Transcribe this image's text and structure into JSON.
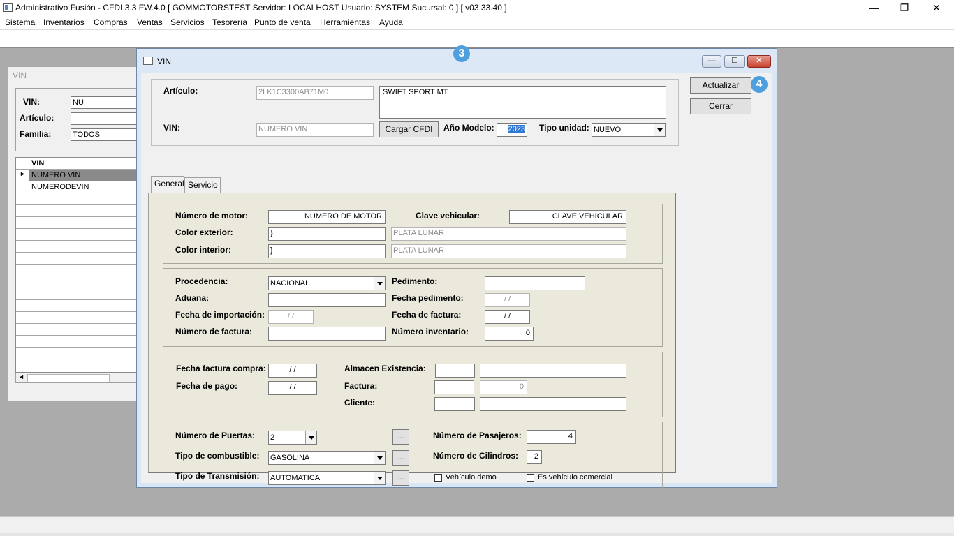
{
  "app": {
    "title": "Administrativo Fusión - CFDI 3.3 FW.4.0 [ GOMMOTORSTEST  Servidor: LOCALHOST  Usuario: SYSTEM    Sucursal: 0 ] [ v03.33.40 ]",
    "minimize": "—",
    "maximize": "❐",
    "close": "✕"
  },
  "menu": [
    "Sistema",
    "Inventarios",
    "Compras",
    "Ventas",
    "Servicios",
    "Tesorería",
    "Punto de venta",
    "Herramientas",
    "Ayuda"
  ],
  "background_window": {
    "title": "VIN",
    "vin_label": "VIN:",
    "vin_value": "NU",
    "articulo_label": "Artículo:",
    "articulo_value": "",
    "familia_label": "Familia:",
    "familia_value": "TODOS",
    "grid_header": "VIN",
    "rows": [
      "NUMERO VIN",
      "NUMERODEVIN"
    ]
  },
  "vin_window": {
    "title": "VIN",
    "articulo_label": "Artículo:",
    "articulo_code": "2LK1C3300AB71M0",
    "articulo_desc": "SWIFT SPORT MT",
    "vin_label": "VIN:",
    "vin_value": "NUMERO VIN",
    "cargar_cfdi": "Cargar CFDI",
    "anio_label": "Año Modelo:",
    "anio_value": "2023",
    "tipo_unidad_label": "Tipo unidad:",
    "tipo_unidad_value": "NUEVO",
    "actualizar": "Actualizar",
    "cerrar": "Cerrar",
    "tabs": [
      "General",
      "Servicio"
    ],
    "motor_label": "Número de motor:",
    "motor_value": "NUMERO DE MOTOR",
    "clave_label": "Clave vehicular:",
    "clave_value": "CLAVE VEHICULAR",
    "color_ext_label": "Color exterior:",
    "color_ext_code": "}",
    "color_ext_desc": "PLATA LUNAR",
    "color_int_label": "Color interior:",
    "color_int_code": "}",
    "color_int_desc": "PLATA LUNAR",
    "procedencia_label": "Procedencia:",
    "procedencia_value": "NACIONAL",
    "pedimento_label": "Pedimento:",
    "pedimento_value": "",
    "aduana_label": "Aduana:",
    "aduana_value": "",
    "fecha_pedimento_label": "Fecha pedimento:",
    "fecha_pedimento_value": "/ /",
    "fecha_import_label": "Fecha de importación:",
    "fecha_import_value": "/ /",
    "fecha_factura_label": "Fecha de factura:",
    "fecha_factura_value": "/ /",
    "num_factura_label": "Número de factura:",
    "num_factura_value": "",
    "num_inventario_label": "Número inventario:",
    "num_inventario_value": "0",
    "fecha_fact_compra_label": "Fecha factura compra:",
    "fecha_fact_compra_value": "/ /",
    "almacen_label": "Almacen Existencia:",
    "fecha_pago_label": "Fecha de pago:",
    "fecha_pago_value": "/ /",
    "factura_label": "Factura:",
    "factura_value": "0",
    "cliente_label": "Cliente:",
    "puertas_label": "Número de Puertas:",
    "puertas_value": "2",
    "pasajeros_label": "Número de Pasajeros:",
    "pasajeros_value": "4",
    "combustible_label": "Tipo de combustible:",
    "combustible_value": "GASOLINA",
    "cilindros_label": "Número de Cilindros:",
    "cilindros_value": "2",
    "transmision_label": "Tipo de Transmisión:",
    "transmision_value": "AUTOMATICA",
    "ellipsis": "...",
    "demo_label": "Vehículo demo",
    "comercial_label": "Es vehículo comercial",
    "window_buttons": {
      "min": "—",
      "max": "☐",
      "close": "✕"
    }
  },
  "badges": [
    "3",
    "4"
  ],
  "colors": {
    "accent": "#4e9fde",
    "mdi_bg": "#ababab",
    "panel": "#ebe8dc"
  }
}
